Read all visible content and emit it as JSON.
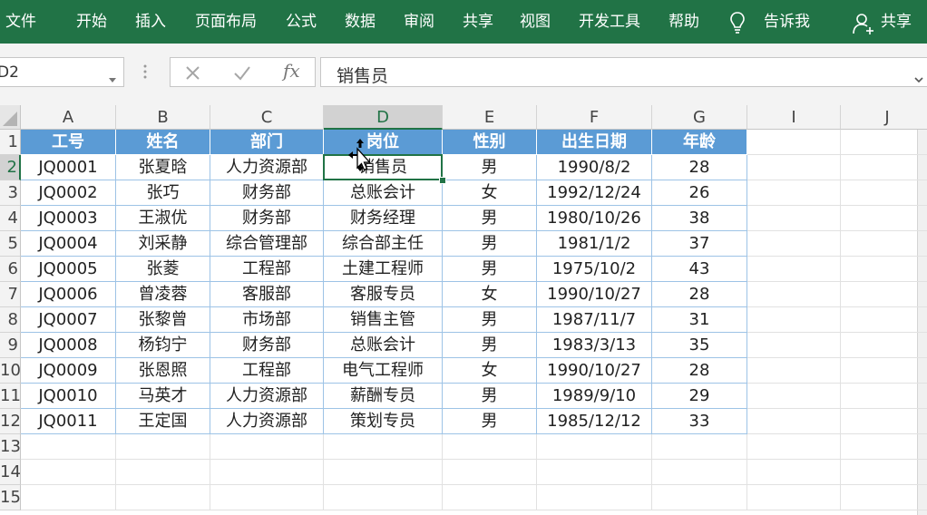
{
  "ribbon": {
    "tabs": [
      "文件",
      "开始",
      "插入",
      "页面布局",
      "公式",
      "数据",
      "审阅",
      "共享",
      "视图",
      "开发工具",
      "帮助"
    ],
    "tell_me": "告诉我",
    "share": "共享",
    "icons": [
      "lightbulb-icon",
      "person-add-icon"
    ]
  },
  "formula_bar": {
    "name_box": "D2",
    "formula_value": "销售员",
    "icons": [
      "cancel-icon",
      "enter-icon",
      "fx-icon"
    ]
  },
  "sheet": {
    "columns": [
      "A",
      "B",
      "C",
      "D",
      "E",
      "F",
      "G",
      "I",
      "J"
    ],
    "rows": [
      "1",
      "2",
      "3",
      "4",
      "5",
      "6",
      "7",
      "8",
      "9",
      "10",
      "11",
      "12",
      "13",
      "14",
      "15"
    ],
    "selected_cell": "D2",
    "table_colors": {
      "header_fill": "#5b9bd5",
      "border": "#9dc3e6",
      "accent": "#217346"
    },
    "table_header": [
      "工号",
      "姓名",
      "部门",
      "岗位",
      "性别",
      "出生日期",
      "年龄"
    ],
    "table_rows": [
      [
        "JQ0001",
        "张夏晗",
        "人力资源部",
        "销售员",
        "男",
        "1990/8/2",
        "28"
      ],
      [
        "JQ0002",
        "张巧",
        "财务部",
        "总账会计",
        "女",
        "1992/12/24",
        "26"
      ],
      [
        "JQ0003",
        "王淑优",
        "财务部",
        "财务经理",
        "男",
        "1980/10/26",
        "38"
      ],
      [
        "JQ0004",
        "刘采静",
        "综合管理部",
        "综合部主任",
        "男",
        "1981/1/2",
        "37"
      ],
      [
        "JQ0005",
        "张菱",
        "工程部",
        "土建工程师",
        "男",
        "1975/10/2",
        "43"
      ],
      [
        "JQ0006",
        "曾凌蓉",
        "客服部",
        "客服专员",
        "女",
        "1990/10/27",
        "28"
      ],
      [
        "JQ0007",
        "张黎曾",
        "市场部",
        "销售主管",
        "男",
        "1987/11/7",
        "31"
      ],
      [
        "JQ0008",
        "杨钧宁",
        "财务部",
        "总账会计",
        "男",
        "1983/3/13",
        "35"
      ],
      [
        "JQ0009",
        "张恩照",
        "工程部",
        "电气工程师",
        "女",
        "1990/10/27",
        "28"
      ],
      [
        "JQ0010",
        "马英才",
        "人力资源部",
        "薪酬专员",
        "男",
        "1989/9/10",
        "29"
      ],
      [
        "JQ0011",
        "王定国",
        "人力资源部",
        "策划专员",
        "男",
        "1985/12/12",
        "33"
      ]
    ]
  }
}
